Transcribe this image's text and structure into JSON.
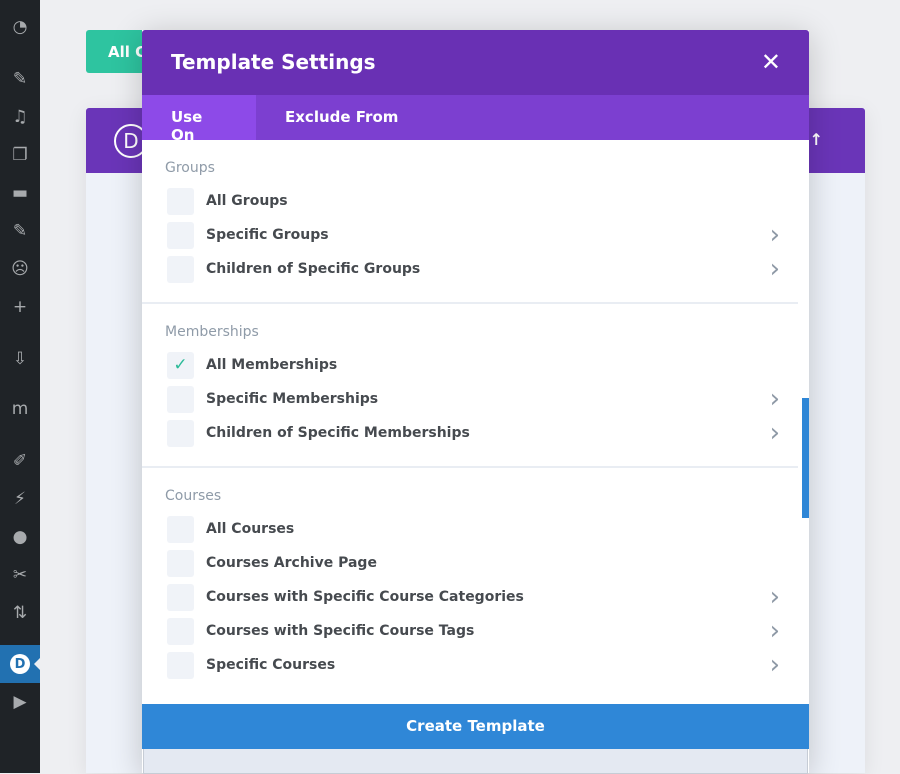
{
  "sidebar": {
    "items": [
      {
        "icon": "dashboard-icon",
        "glyph": "◔"
      },
      {
        "icon": "pin-icon",
        "glyph": "✎"
      },
      {
        "icon": "media-icon",
        "glyph": "♫"
      },
      {
        "icon": "pages-icon",
        "glyph": "❐"
      },
      {
        "icon": "comments-icon",
        "glyph": "▬"
      },
      {
        "icon": "pin-icon",
        "glyph": "✎"
      },
      {
        "icon": "bot-icon",
        "glyph": "☹"
      },
      {
        "icon": "plus-icon",
        "glyph": "+"
      },
      {
        "icon": "download-icon",
        "glyph": "⇩"
      },
      {
        "icon": "memberpress-icon",
        "glyph": "m"
      },
      {
        "icon": "appearance-icon",
        "glyph": "✐"
      },
      {
        "icon": "plugins-icon",
        "glyph": "⚡"
      },
      {
        "icon": "users-icon",
        "glyph": "●"
      },
      {
        "icon": "tools-icon",
        "glyph": "✂"
      },
      {
        "icon": "settings-icon",
        "glyph": "⇅"
      },
      {
        "icon": "divi-icon",
        "glyph": "D",
        "active": true
      },
      {
        "icon": "play-icon",
        "glyph": "▶"
      }
    ]
  },
  "background": {
    "button_label": "All C",
    "logo": "D",
    "sort_glyph": "↓↑"
  },
  "modal": {
    "title": "Template Settings",
    "close_glyph": "✕",
    "tabs": [
      "Use On",
      "Exclude From"
    ],
    "sections": [
      {
        "title": "Groups",
        "items": [
          {
            "label": "All Groups",
            "checked": false,
            "chevron": false
          },
          {
            "label": "Specific Groups",
            "checked": false,
            "chevron": true
          },
          {
            "label": "Children of Specific Groups",
            "checked": false,
            "chevron": true
          }
        ]
      },
      {
        "title": "Memberships",
        "items": [
          {
            "label": "All Memberships",
            "checked": true,
            "chevron": false
          },
          {
            "label": "Specific Memberships",
            "checked": false,
            "chevron": true
          },
          {
            "label": "Children of Specific Memberships",
            "checked": false,
            "chevron": true
          }
        ]
      },
      {
        "title": "Courses",
        "items": [
          {
            "label": "All Courses",
            "checked": false,
            "chevron": false
          },
          {
            "label": "Courses Archive Page",
            "checked": false,
            "chevron": false
          },
          {
            "label": "Courses with Specific Course Categories",
            "checked": false,
            "chevron": true
          },
          {
            "label": "Courses with Specific Course Tags",
            "checked": false,
            "chevron": true
          },
          {
            "label": "Specific Courses",
            "checked": false,
            "chevron": true
          }
        ]
      }
    ],
    "create_label": "Create Template"
  },
  "colors": {
    "header": "#6930b4",
    "tabs": "#7c3fd0",
    "active_tab": "#8d4ae8",
    "primary": "#2f87d7",
    "check": "#2cbb98",
    "sidebar": "#1f2327"
  }
}
